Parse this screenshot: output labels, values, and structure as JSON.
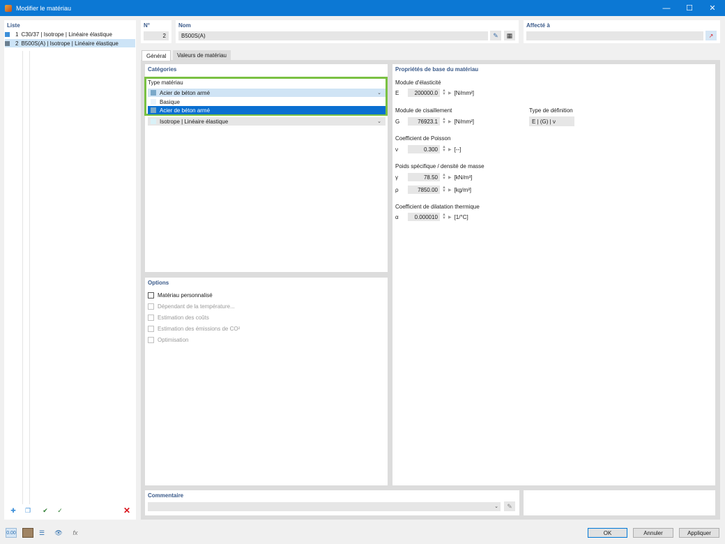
{
  "window": {
    "title": "Modifier le matériau"
  },
  "list": {
    "header": "Liste",
    "items": [
      {
        "num": "1",
        "label": "C30/37 | Isotrope | Linéaire élastique",
        "color": "#3d8fd9"
      },
      {
        "num": "2",
        "label": "B500S(A) | Isotrope | Linéaire élastique",
        "color": "#6b7f90"
      }
    ],
    "selected_index": 1
  },
  "number": {
    "header": "N°",
    "value": "2"
  },
  "name": {
    "header": "Nom",
    "value": "B500S(A)"
  },
  "assigned": {
    "header": "Affecté à",
    "value": ""
  },
  "tabs": [
    "Général",
    "Valeurs de matériau"
  ],
  "categories": {
    "header": "Catégories",
    "type_label": "Type matériau",
    "type_value": "Acier de béton armé",
    "options": [
      "Basique",
      "Acier de béton armé"
    ],
    "model_value": "Isotrope | Linéaire élastique"
  },
  "options_section": {
    "header": "Options",
    "items": [
      {
        "label": "Matériau personnalisé",
        "enabled": true,
        "checked": false
      },
      {
        "label": "Dépendant de la température...",
        "enabled": false,
        "checked": false
      },
      {
        "label": "Estimation des coûts",
        "enabled": false,
        "checked": false
      },
      {
        "label": "Estimation des émissions de CO²",
        "enabled": false,
        "checked": false
      },
      {
        "label": "Optimisation",
        "enabled": false,
        "checked": false
      }
    ]
  },
  "properties": {
    "header": "Propriétés de base du matériau",
    "elasticity": {
      "label": "Module d'élasticité",
      "symbol": "E",
      "value": "200000.0",
      "unit": "[N/mm²]"
    },
    "shear": {
      "label": "Module de cisaillement",
      "symbol": "G",
      "value": "76923.1",
      "unit": "[N/mm²]"
    },
    "definition": {
      "label": "Type de définition",
      "value": "E | (G) | ν"
    },
    "poisson": {
      "label": "Coefficient de Poisson",
      "symbol": "ν",
      "value": "0.300",
      "unit": "[--]"
    },
    "weight": {
      "label": "Poids spécifique / densité de masse",
      "gamma_symbol": "γ",
      "gamma_value": "78.50",
      "gamma_unit": "[kN/m³]",
      "rho_symbol": "ρ",
      "rho_value": "7850.00",
      "rho_unit": "[kg/m³]"
    },
    "thermal": {
      "label": "Coefficient de dilatation thermique",
      "symbol": "α",
      "value": "0.000010",
      "unit": "[1/°C]"
    }
  },
  "comment": {
    "header": "Commentaire",
    "value": ""
  },
  "buttons": {
    "ok": "OK",
    "cancel": "Annuler",
    "apply": "Appliquer"
  },
  "colors": {
    "accent": "#0c78d4",
    "highlight_border": "#7ac143",
    "selection": "#0a6fd1",
    "header_text": "#3a5a8a",
    "delete_red": "#d9141c"
  }
}
